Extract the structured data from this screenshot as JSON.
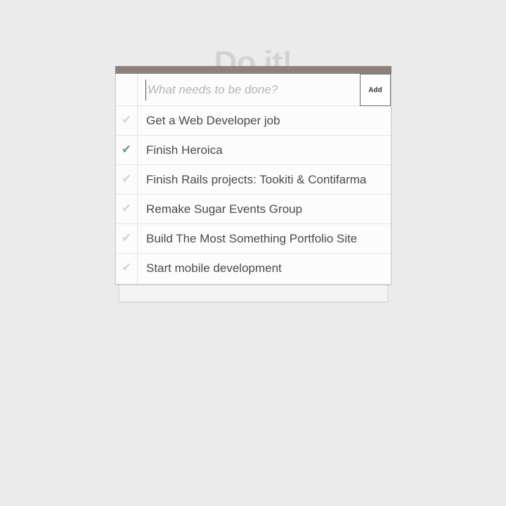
{
  "app": {
    "title": "Do it!"
  },
  "new_todo": {
    "placeholder": "What needs to be done?",
    "value": "",
    "add_label": "Add"
  },
  "todos": [
    {
      "text": "Get a Web Developer job",
      "done": false
    },
    {
      "text": "Finish Heroica",
      "done": true
    },
    {
      "text": "Finish Rails projects: Tookiti & Contifarma",
      "done": false
    },
    {
      "text": "Remake Sugar Events Group",
      "done": false
    },
    {
      "text": "Build The Most Something Portfolio Site",
      "done": false
    },
    {
      "text": "Start mobile development",
      "done": false
    }
  ],
  "icons": {
    "check": "check-icon"
  },
  "colors": {
    "background": "#ebebeb",
    "card_topbar": "#8e807c",
    "check_done": "#6f9a8c",
    "check_pending": "#d4d4d4",
    "margin_line": "#f3d6da",
    "title": "#d2d2d2"
  }
}
